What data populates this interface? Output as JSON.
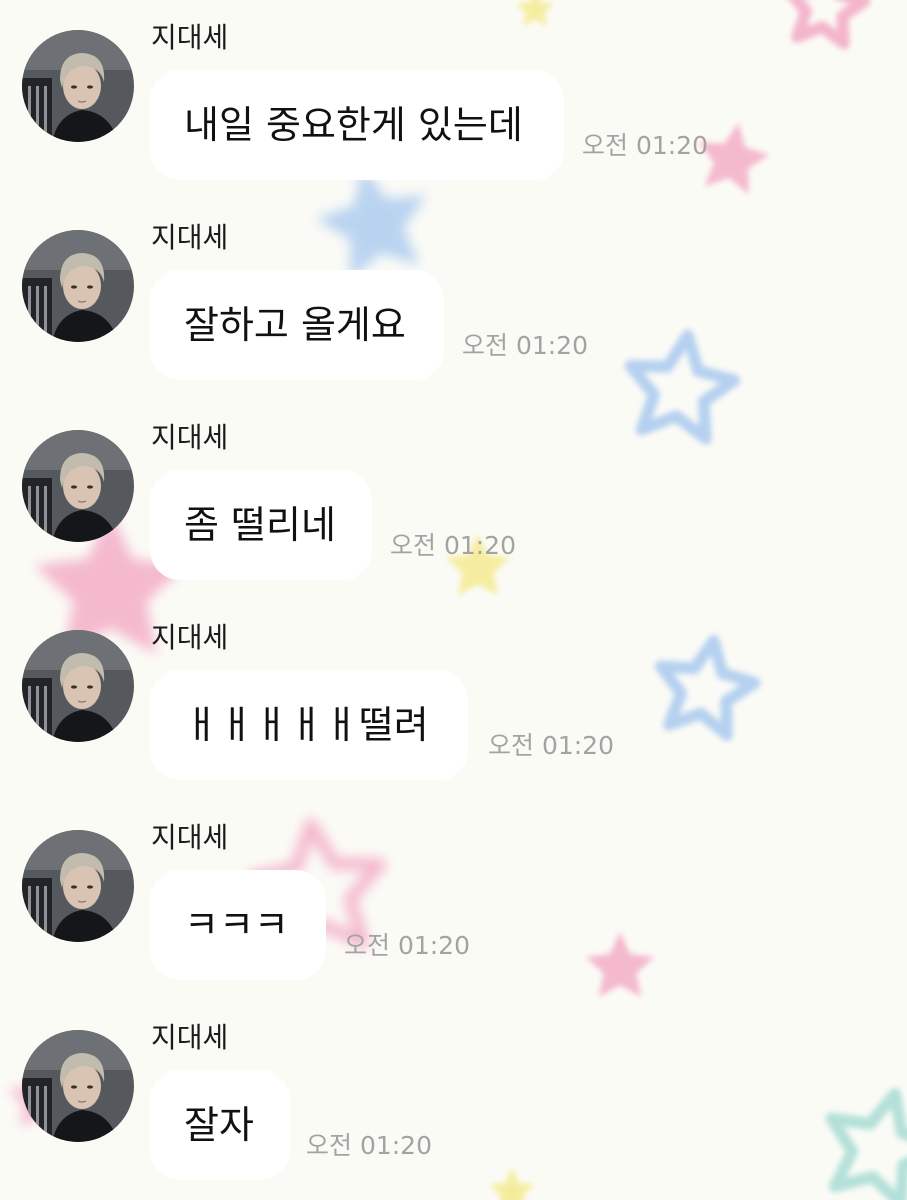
{
  "colors": {
    "background": "#fbfbf6",
    "bubble": "#ffffff",
    "sender_text": "#1b1b1b",
    "message_text": "#111111",
    "timestamp": "#a3a3a3",
    "star_pink": "#f3a9c4",
    "star_blue": "#a9c9ef",
    "star_yellow": "#f4e98a",
    "star_teal": "#a7dcd4"
  },
  "messages": [
    {
      "sender": "지대세",
      "avatar_icon": "profile-photo",
      "text": "내일 중요한게 있는데",
      "time": "오전 01:20"
    },
    {
      "sender": "지대세",
      "avatar_icon": "profile-photo",
      "text": "잘하고 올게요",
      "time": "오전 01:20"
    },
    {
      "sender": "지대세",
      "avatar_icon": "profile-photo",
      "text": "좀 떨리네",
      "time": "오전 01:20"
    },
    {
      "sender": "지대세",
      "avatar_icon": "profile-photo",
      "text": "ㅐㅐㅐㅐㅐ떨려",
      "time": "오전 01:20"
    },
    {
      "sender": "지대세",
      "avatar_icon": "profile-photo",
      "text": "ㅋㅋㅋ",
      "time": "오전 01:20"
    },
    {
      "sender": "지대세",
      "avatar_icon": "profile-photo",
      "text": "잘자",
      "time": "오전 01:20"
    }
  ]
}
